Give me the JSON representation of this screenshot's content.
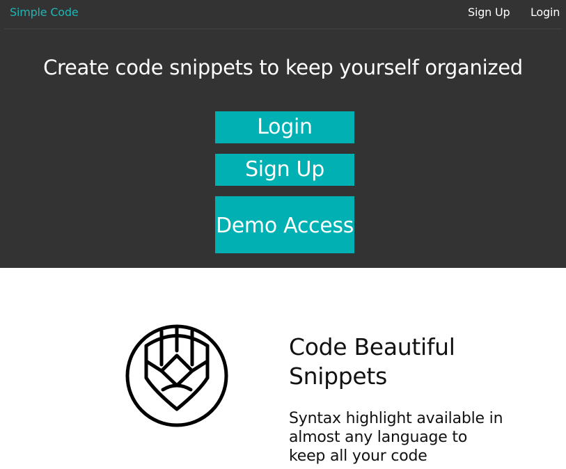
{
  "navbar": {
    "brand": "Simple Code",
    "links": [
      "Sign Up",
      "Login"
    ]
  },
  "hero": {
    "title": "Create code snippets to keep yourself organized",
    "buttons": {
      "login": "Login",
      "signup": "Sign Up",
      "demo": "Demo Access"
    }
  },
  "feature": {
    "icon": "pencil-circle-icon",
    "title": "Code Beautiful Snippets",
    "description": "Syntax highlight available in almost any language to keep all your code"
  },
  "colors": {
    "accent": "#00b0b3",
    "brand": "#1fb5b5",
    "hero_bg": "#333333"
  }
}
